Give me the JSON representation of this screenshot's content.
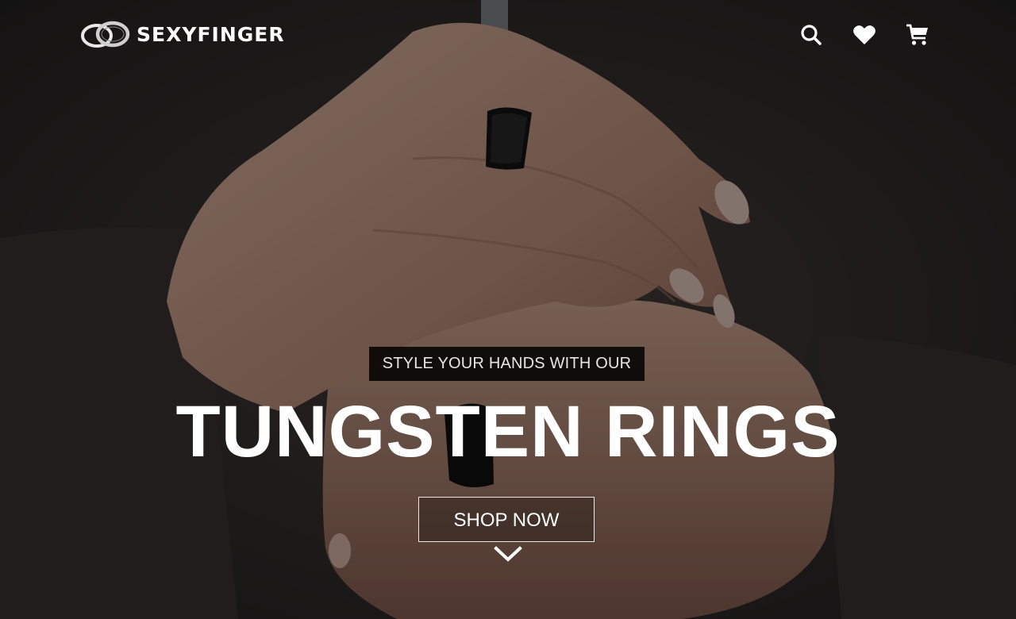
{
  "header": {
    "logo_text": "SEXYFINGER",
    "icons": [
      "search-icon",
      "heart-icon",
      "cart-icon"
    ]
  },
  "hero": {
    "tagline": "STYLE YOUR HANDS WITH OUR",
    "headline": "TUNGSTEN RINGS",
    "cta_label": "SHOP NOW",
    "scroll_icon": "chevron-down-icon"
  },
  "colors": {
    "text": "#ffffff",
    "tagline_bg": "#000000"
  }
}
